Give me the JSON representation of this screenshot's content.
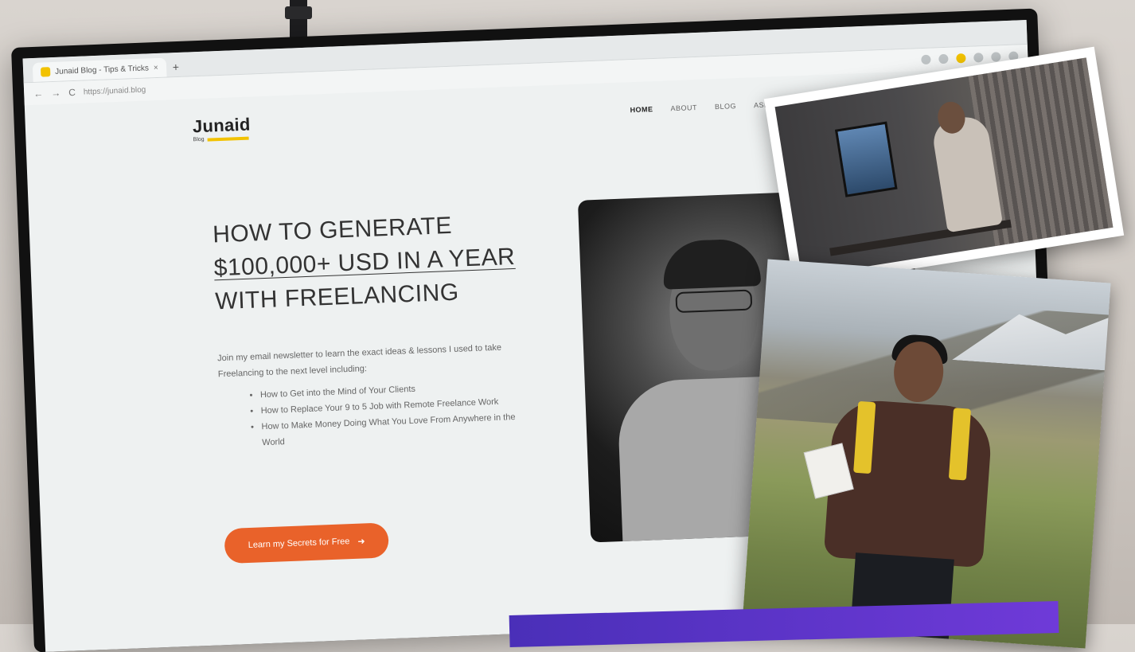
{
  "browser": {
    "tab_title": "Junaid Blog - Tips & Tricks",
    "tab_close": "×",
    "new_tab": "+",
    "url": "https://junaid.blog",
    "back": "←",
    "forward": "→",
    "reload": "C"
  },
  "site": {
    "logo_name": "Junaid",
    "logo_sub": "Blog",
    "nav": [
      "HOME",
      "ABOUT",
      "BLOG",
      "ASK"
    ]
  },
  "hero": {
    "headline_1": "HOW TO GENERATE",
    "headline_2": "$100,000+ USD IN A YEAR",
    "headline_3": "WITH FREELANCING",
    "intro": "Join my email newsletter to learn the exact ideas & lessons I used to take Freelancing to the next level including:",
    "bullets": [
      "How to Get into the Mind of Your Clients",
      "How to Replace Your 9 to 5 Job with Remote Freelance Work",
      "How to Make Money Doing What You Love From Anywhere in the World"
    ],
    "cta_label": "Learn my Secrets for Free",
    "cta_arrow": "➜"
  },
  "colors": {
    "accent_orange": "#e9622a",
    "brand_yellow": "#f2c200",
    "page_bg": "#eef1f1"
  }
}
